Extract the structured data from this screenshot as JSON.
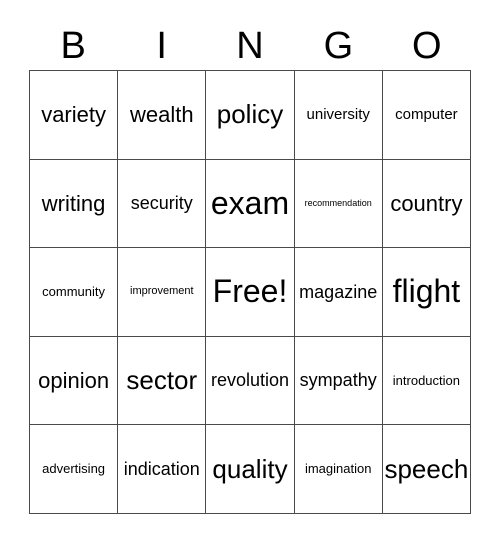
{
  "header": {
    "letters": [
      "B",
      "I",
      "N",
      "G",
      "O"
    ]
  },
  "colors": {
    "background": "#ffffff",
    "grid_line": "#4a4a4a",
    "text": "#000000"
  },
  "grid": {
    "columns": 5,
    "rows": 5,
    "free_space_label": "Free!",
    "cells": [
      {
        "text": "variety",
        "size": "s-2xl"
      },
      {
        "text": "wealth",
        "size": "s-2xl"
      },
      {
        "text": "policy",
        "size": "s-3xl"
      },
      {
        "text": "university",
        "size": "s-lg"
      },
      {
        "text": "computer",
        "size": "s-lg"
      },
      {
        "text": "writing",
        "size": "s-2xl"
      },
      {
        "text": "security",
        "size": "s-xl"
      },
      {
        "text": "exam",
        "size": "s-4xl"
      },
      {
        "text": "recommendation",
        "size": "s-xs"
      },
      {
        "text": "country",
        "size": "s-2xl"
      },
      {
        "text": "community",
        "size": "s-md"
      },
      {
        "text": "improvement",
        "size": "s-sm"
      },
      {
        "text": "Free!",
        "size": "s-4xl"
      },
      {
        "text": "magazine",
        "size": "s-xl"
      },
      {
        "text": "flight",
        "size": "s-4xl"
      },
      {
        "text": "opinion",
        "size": "s-2xl"
      },
      {
        "text": "sector",
        "size": "s-3xl"
      },
      {
        "text": "revolution",
        "size": "s-xl"
      },
      {
        "text": "sympathy",
        "size": "s-xl"
      },
      {
        "text": "introduction",
        "size": "s-md"
      },
      {
        "text": "advertising",
        "size": "s-md"
      },
      {
        "text": "indication",
        "size": "s-xl"
      },
      {
        "text": "quality",
        "size": "s-3xl"
      },
      {
        "text": "imagination",
        "size": "s-md"
      },
      {
        "text": "speech",
        "size": "s-3xl"
      }
    ]
  }
}
